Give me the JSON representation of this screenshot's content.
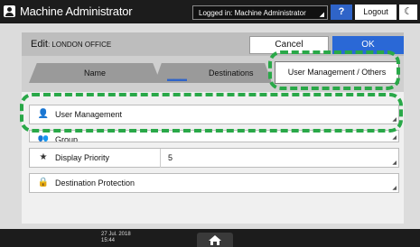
{
  "topbar": {
    "app_title": "Machine Administrator",
    "login_status": "Logged in: Machine Administrator",
    "help_label": "?",
    "logout_label": "Logout",
    "moon_label": "☾"
  },
  "dialog": {
    "title_main": "Edit",
    "title_sub": ": LONDON OFFICE",
    "cancel_label": "Cancel",
    "ok_label": "OK"
  },
  "tabs": [
    {
      "label": "Name",
      "selected": false
    },
    {
      "label": "Destinations",
      "selected": false
    },
    {
      "label": "User Management / Others",
      "selected": true
    }
  ],
  "rows": [
    {
      "label": "User Management",
      "icon": "user-lock-icon"
    },
    {
      "label": "Group",
      "icon": "group-icon"
    },
    {
      "label": "Display Priority",
      "value": "5",
      "icon": "star-icon"
    },
    {
      "label": "Destination Protection",
      "icon": "lock-icon"
    }
  ],
  "bottombar": {
    "date": "27 Jul. 2018",
    "time": "15:44"
  },
  "colors": {
    "callout": "#29a848",
    "ok_button": "#2a68d6",
    "help_button": "#2f64c8"
  }
}
